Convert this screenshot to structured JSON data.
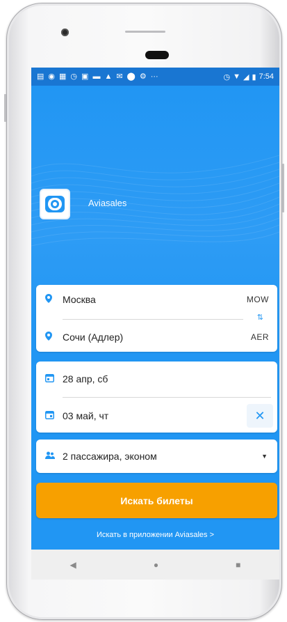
{
  "status_bar": {
    "time": "7:54",
    "left_icons": [
      "notification-icon",
      "location-icon",
      "calendar-icon",
      "alarm-icon",
      "gallery-icon",
      "message-icon",
      "drive-icon",
      "mail-icon",
      "location-icon",
      "settings-icon",
      "more-icon"
    ],
    "more_dots": "···"
  },
  "hero": {
    "brand_name": "Aviasales"
  },
  "route": {
    "origin": {
      "city": "Москва",
      "code": "MOW"
    },
    "destination": {
      "city": "Сочи (Адлер)",
      "code": "AER"
    },
    "swap_glyph": "⇅"
  },
  "dates": {
    "departure": "28 апр, сб",
    "return": "03 май, чт",
    "clear_glyph": "✕"
  },
  "passengers": {
    "label": "2 пассажира, эконом",
    "arrow_glyph": "▼"
  },
  "search_button": {
    "label": "Искать билеты"
  },
  "app_link": {
    "label": "Искать в приложении Aviasales  >"
  },
  "navbar": {
    "back_glyph": "◀",
    "home_glyph": "●",
    "recents_glyph": "■"
  },
  "colors": {
    "primary_blue": "#2196f3",
    "status_blue": "#1976d2",
    "accent_orange": "#f7a000"
  }
}
